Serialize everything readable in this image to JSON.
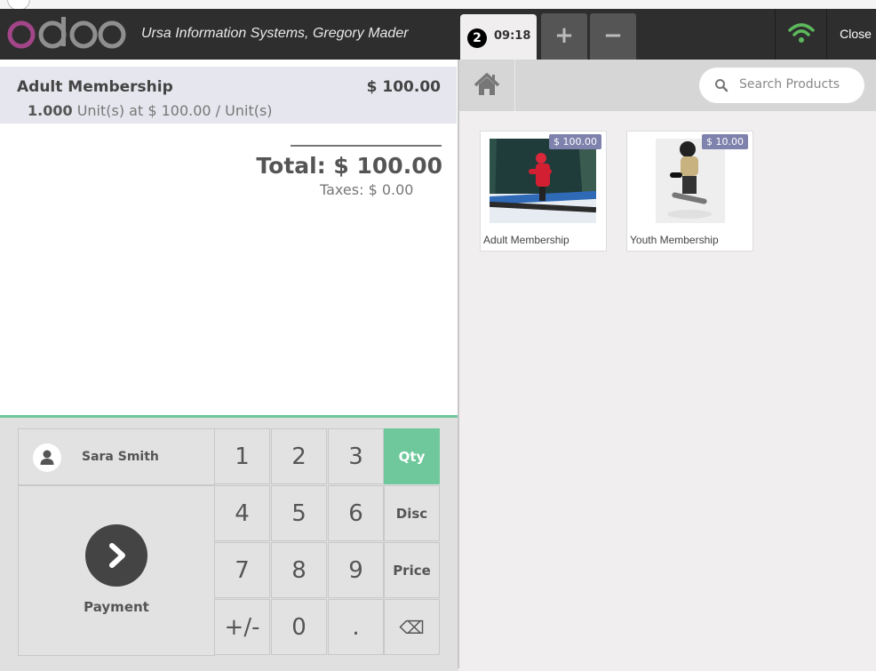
{
  "header": {
    "logo_text": "odoo",
    "company_user": "Ursa Information Systems, Gregory Mader",
    "order": {
      "number": "2",
      "time": "09:18"
    },
    "add_order_symbol": "+",
    "remove_order_symbol": "−",
    "close_label": "Close"
  },
  "order": {
    "line": {
      "product": "Adult Membership",
      "price": "$ 100.00",
      "quantity": "1.000",
      "unit_info": "Unit(s) at $ 100.00 / Unit(s)"
    },
    "total": "Total: $ 100.00",
    "taxes": "Taxes: $ 0.00"
  },
  "actionpad": {
    "customer": "Sara Smith",
    "payment": "Payment"
  },
  "numpad": {
    "k1": "1",
    "k2": "2",
    "k3": "3",
    "k4": "4",
    "k5": "5",
    "k6": "6",
    "k7": "7",
    "k8": "8",
    "k9": "9",
    "sign": "+/-",
    "k0": "0",
    "dot": ".",
    "qty": "Qty",
    "disc": "Disc",
    "price": "Price",
    "backspace": "⌫"
  },
  "products": {
    "search_placeholder": "Search Products",
    "items": [
      {
        "name": "Adult Membership",
        "price": "$ 100.00"
      },
      {
        "name": "Youth Membership",
        "price": "$ 10.00"
      }
    ]
  },
  "colors": {
    "accent_green": "#6ec89b",
    "price_tag": "#7f82ac",
    "logo_purple": "#a24689",
    "wifi_green": "#5cb85c"
  }
}
